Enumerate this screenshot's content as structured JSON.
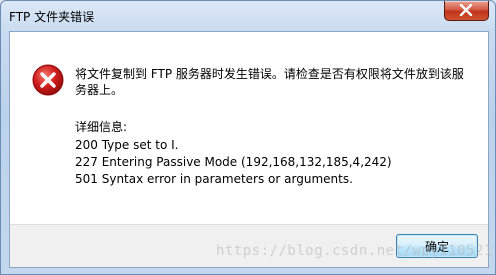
{
  "window": {
    "title": "FTP 文件夹错误"
  },
  "titlebar": {
    "close_icon": "close-icon",
    "close_color": "#c7402a"
  },
  "dialog": {
    "icon": "error-icon",
    "icon_color": "#d11f1f",
    "message": "将文件复制到 FTP 服务器时发生错误。请检查是否有权限将文件放到该服务器上。",
    "details_heading": "详细信息:",
    "details": [
      "200 Type set to I.",
      "227 Entering Passive Mode (192,168,132,185,4,242)",
      "501 Syntax error in parameters or arguments."
    ]
  },
  "footer": {
    "ok_label": "确定"
  },
  "watermark": {
    "text": "https://blog.csdn.net/wpyi10521"
  }
}
